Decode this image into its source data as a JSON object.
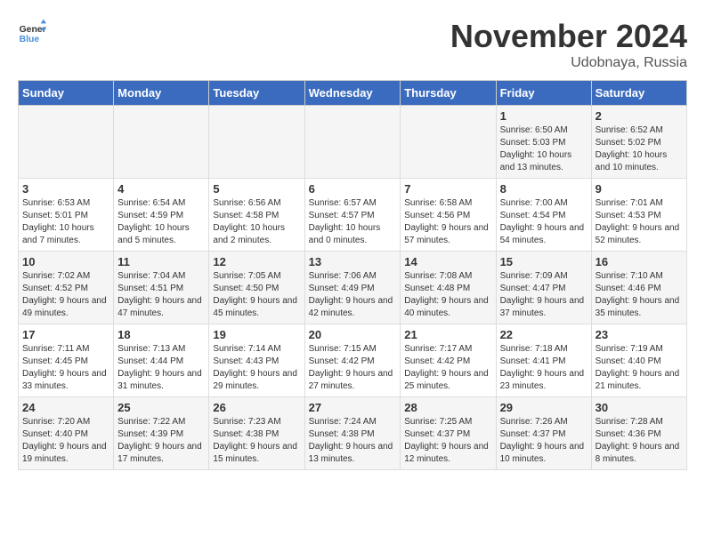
{
  "header": {
    "logo_line1": "General",
    "logo_line2": "Blue",
    "month": "November 2024",
    "location": "Udobnaya, Russia"
  },
  "weekdays": [
    "Sunday",
    "Monday",
    "Tuesday",
    "Wednesday",
    "Thursday",
    "Friday",
    "Saturday"
  ],
  "weeks": [
    [
      {
        "day": "",
        "sunrise": "",
        "sunset": "",
        "daylight": ""
      },
      {
        "day": "",
        "sunrise": "",
        "sunset": "",
        "daylight": ""
      },
      {
        "day": "",
        "sunrise": "",
        "sunset": "",
        "daylight": ""
      },
      {
        "day": "",
        "sunrise": "",
        "sunset": "",
        "daylight": ""
      },
      {
        "day": "",
        "sunrise": "",
        "sunset": "",
        "daylight": ""
      },
      {
        "day": "1",
        "sunrise": "Sunrise: 6:50 AM",
        "sunset": "Sunset: 5:03 PM",
        "daylight": "Daylight: 10 hours and 13 minutes."
      },
      {
        "day": "2",
        "sunrise": "Sunrise: 6:52 AM",
        "sunset": "Sunset: 5:02 PM",
        "daylight": "Daylight: 10 hours and 10 minutes."
      }
    ],
    [
      {
        "day": "3",
        "sunrise": "Sunrise: 6:53 AM",
        "sunset": "Sunset: 5:01 PM",
        "daylight": "Daylight: 10 hours and 7 minutes."
      },
      {
        "day": "4",
        "sunrise": "Sunrise: 6:54 AM",
        "sunset": "Sunset: 4:59 PM",
        "daylight": "Daylight: 10 hours and 5 minutes."
      },
      {
        "day": "5",
        "sunrise": "Sunrise: 6:56 AM",
        "sunset": "Sunset: 4:58 PM",
        "daylight": "Daylight: 10 hours and 2 minutes."
      },
      {
        "day": "6",
        "sunrise": "Sunrise: 6:57 AM",
        "sunset": "Sunset: 4:57 PM",
        "daylight": "Daylight: 10 hours and 0 minutes."
      },
      {
        "day": "7",
        "sunrise": "Sunrise: 6:58 AM",
        "sunset": "Sunset: 4:56 PM",
        "daylight": "Daylight: 9 hours and 57 minutes."
      },
      {
        "day": "8",
        "sunrise": "Sunrise: 7:00 AM",
        "sunset": "Sunset: 4:54 PM",
        "daylight": "Daylight: 9 hours and 54 minutes."
      },
      {
        "day": "9",
        "sunrise": "Sunrise: 7:01 AM",
        "sunset": "Sunset: 4:53 PM",
        "daylight": "Daylight: 9 hours and 52 minutes."
      }
    ],
    [
      {
        "day": "10",
        "sunrise": "Sunrise: 7:02 AM",
        "sunset": "Sunset: 4:52 PM",
        "daylight": "Daylight: 9 hours and 49 minutes."
      },
      {
        "day": "11",
        "sunrise": "Sunrise: 7:04 AM",
        "sunset": "Sunset: 4:51 PM",
        "daylight": "Daylight: 9 hours and 47 minutes."
      },
      {
        "day": "12",
        "sunrise": "Sunrise: 7:05 AM",
        "sunset": "Sunset: 4:50 PM",
        "daylight": "Daylight: 9 hours and 45 minutes."
      },
      {
        "day": "13",
        "sunrise": "Sunrise: 7:06 AM",
        "sunset": "Sunset: 4:49 PM",
        "daylight": "Daylight: 9 hours and 42 minutes."
      },
      {
        "day": "14",
        "sunrise": "Sunrise: 7:08 AM",
        "sunset": "Sunset: 4:48 PM",
        "daylight": "Daylight: 9 hours and 40 minutes."
      },
      {
        "day": "15",
        "sunrise": "Sunrise: 7:09 AM",
        "sunset": "Sunset: 4:47 PM",
        "daylight": "Daylight: 9 hours and 37 minutes."
      },
      {
        "day": "16",
        "sunrise": "Sunrise: 7:10 AM",
        "sunset": "Sunset: 4:46 PM",
        "daylight": "Daylight: 9 hours and 35 minutes."
      }
    ],
    [
      {
        "day": "17",
        "sunrise": "Sunrise: 7:11 AM",
        "sunset": "Sunset: 4:45 PM",
        "daylight": "Daylight: 9 hours and 33 minutes."
      },
      {
        "day": "18",
        "sunrise": "Sunrise: 7:13 AM",
        "sunset": "Sunset: 4:44 PM",
        "daylight": "Daylight: 9 hours and 31 minutes."
      },
      {
        "day": "19",
        "sunrise": "Sunrise: 7:14 AM",
        "sunset": "Sunset: 4:43 PM",
        "daylight": "Daylight: 9 hours and 29 minutes."
      },
      {
        "day": "20",
        "sunrise": "Sunrise: 7:15 AM",
        "sunset": "Sunset: 4:42 PM",
        "daylight": "Daylight: 9 hours and 27 minutes."
      },
      {
        "day": "21",
        "sunrise": "Sunrise: 7:17 AM",
        "sunset": "Sunset: 4:42 PM",
        "daylight": "Daylight: 9 hours and 25 minutes."
      },
      {
        "day": "22",
        "sunrise": "Sunrise: 7:18 AM",
        "sunset": "Sunset: 4:41 PM",
        "daylight": "Daylight: 9 hours and 23 minutes."
      },
      {
        "day": "23",
        "sunrise": "Sunrise: 7:19 AM",
        "sunset": "Sunset: 4:40 PM",
        "daylight": "Daylight: 9 hours and 21 minutes."
      }
    ],
    [
      {
        "day": "24",
        "sunrise": "Sunrise: 7:20 AM",
        "sunset": "Sunset: 4:40 PM",
        "daylight": "Daylight: 9 hours and 19 minutes."
      },
      {
        "day": "25",
        "sunrise": "Sunrise: 7:22 AM",
        "sunset": "Sunset: 4:39 PM",
        "daylight": "Daylight: 9 hours and 17 minutes."
      },
      {
        "day": "26",
        "sunrise": "Sunrise: 7:23 AM",
        "sunset": "Sunset: 4:38 PM",
        "daylight": "Daylight: 9 hours and 15 minutes."
      },
      {
        "day": "27",
        "sunrise": "Sunrise: 7:24 AM",
        "sunset": "Sunset: 4:38 PM",
        "daylight": "Daylight: 9 hours and 13 minutes."
      },
      {
        "day": "28",
        "sunrise": "Sunrise: 7:25 AM",
        "sunset": "Sunset: 4:37 PM",
        "daylight": "Daylight: 9 hours and 12 minutes."
      },
      {
        "day": "29",
        "sunrise": "Sunrise: 7:26 AM",
        "sunset": "Sunset: 4:37 PM",
        "daylight": "Daylight: 9 hours and 10 minutes."
      },
      {
        "day": "30",
        "sunrise": "Sunrise: 7:28 AM",
        "sunset": "Sunset: 4:36 PM",
        "daylight": "Daylight: 9 hours and 8 minutes."
      }
    ]
  ]
}
